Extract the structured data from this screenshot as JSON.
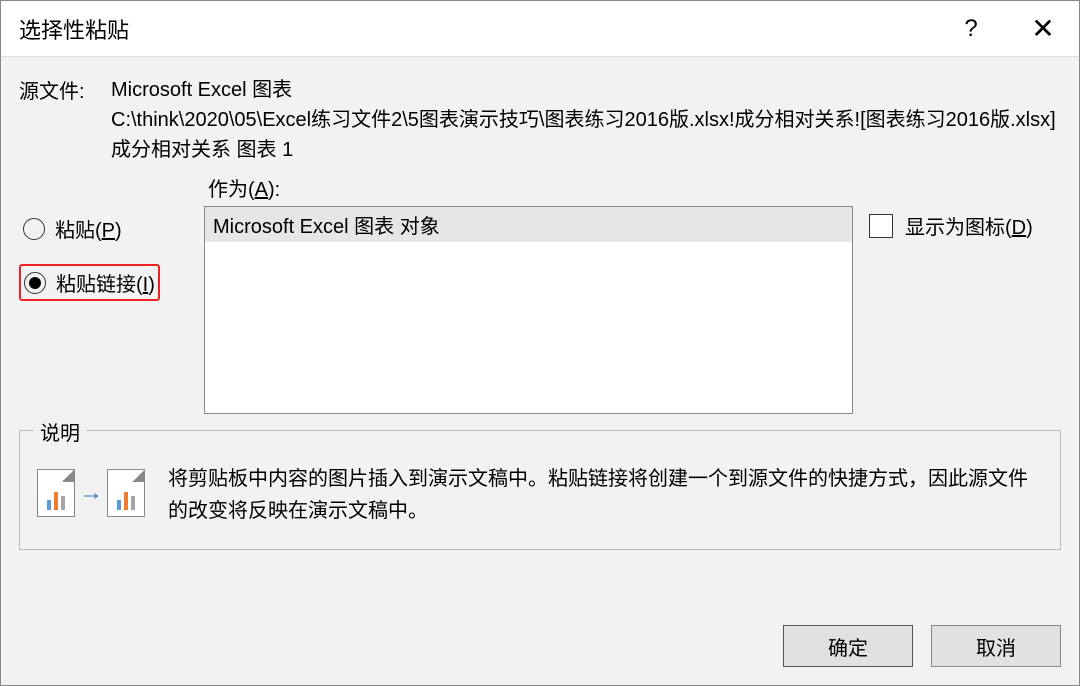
{
  "titlebar": {
    "title": "选择性粘贴",
    "help": "?",
    "close": "✕"
  },
  "source": {
    "label": "源文件:",
    "line1": "Microsoft Excel 图表",
    "line2": "C:\\think\\2020\\05\\Excel练习文件2\\5图表演示技巧\\图表练习2016版.xlsx!成分相对关系![图表练习2016版.xlsx]成分相对关系 图表 1"
  },
  "as": {
    "label_prefix": "作为(",
    "label_key": "A",
    "label_suffix": "):",
    "options": [
      "Microsoft Excel 图表 对象"
    ]
  },
  "radio": {
    "paste_prefix": "粘贴(",
    "paste_key": "P",
    "paste_suffix": ")",
    "paste_link_prefix": "粘贴链接(",
    "paste_link_key": "I",
    "paste_link_suffix": ")"
  },
  "checkbox": {
    "display_as_icon_prefix": "显示为图标(",
    "display_as_icon_key": "D",
    "display_as_icon_suffix": ")"
  },
  "description": {
    "legend": "说明",
    "text": "将剪贴板中内容的图片插入到演示文稿中。粘贴链接将创建一个到源文件的快捷方式，因此源文件的改变将反映在演示文稿中。"
  },
  "buttons": {
    "ok": "确定",
    "cancel": "取消"
  }
}
